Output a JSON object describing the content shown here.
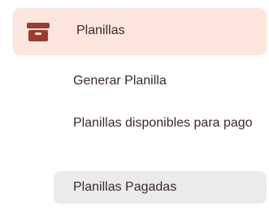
{
  "menu": {
    "group": {
      "label": "Planillas",
      "icon": "archive-box-icon",
      "icon_color": "#9a3b2f",
      "highlight_color": "#fde6de"
    },
    "items": [
      {
        "label": "Generar Planilla"
      },
      {
        "label": "Planillas disponibles para pago"
      },
      {
        "label": "Planillas Pagadas",
        "selected_bg": "#ebebeb"
      }
    ]
  }
}
